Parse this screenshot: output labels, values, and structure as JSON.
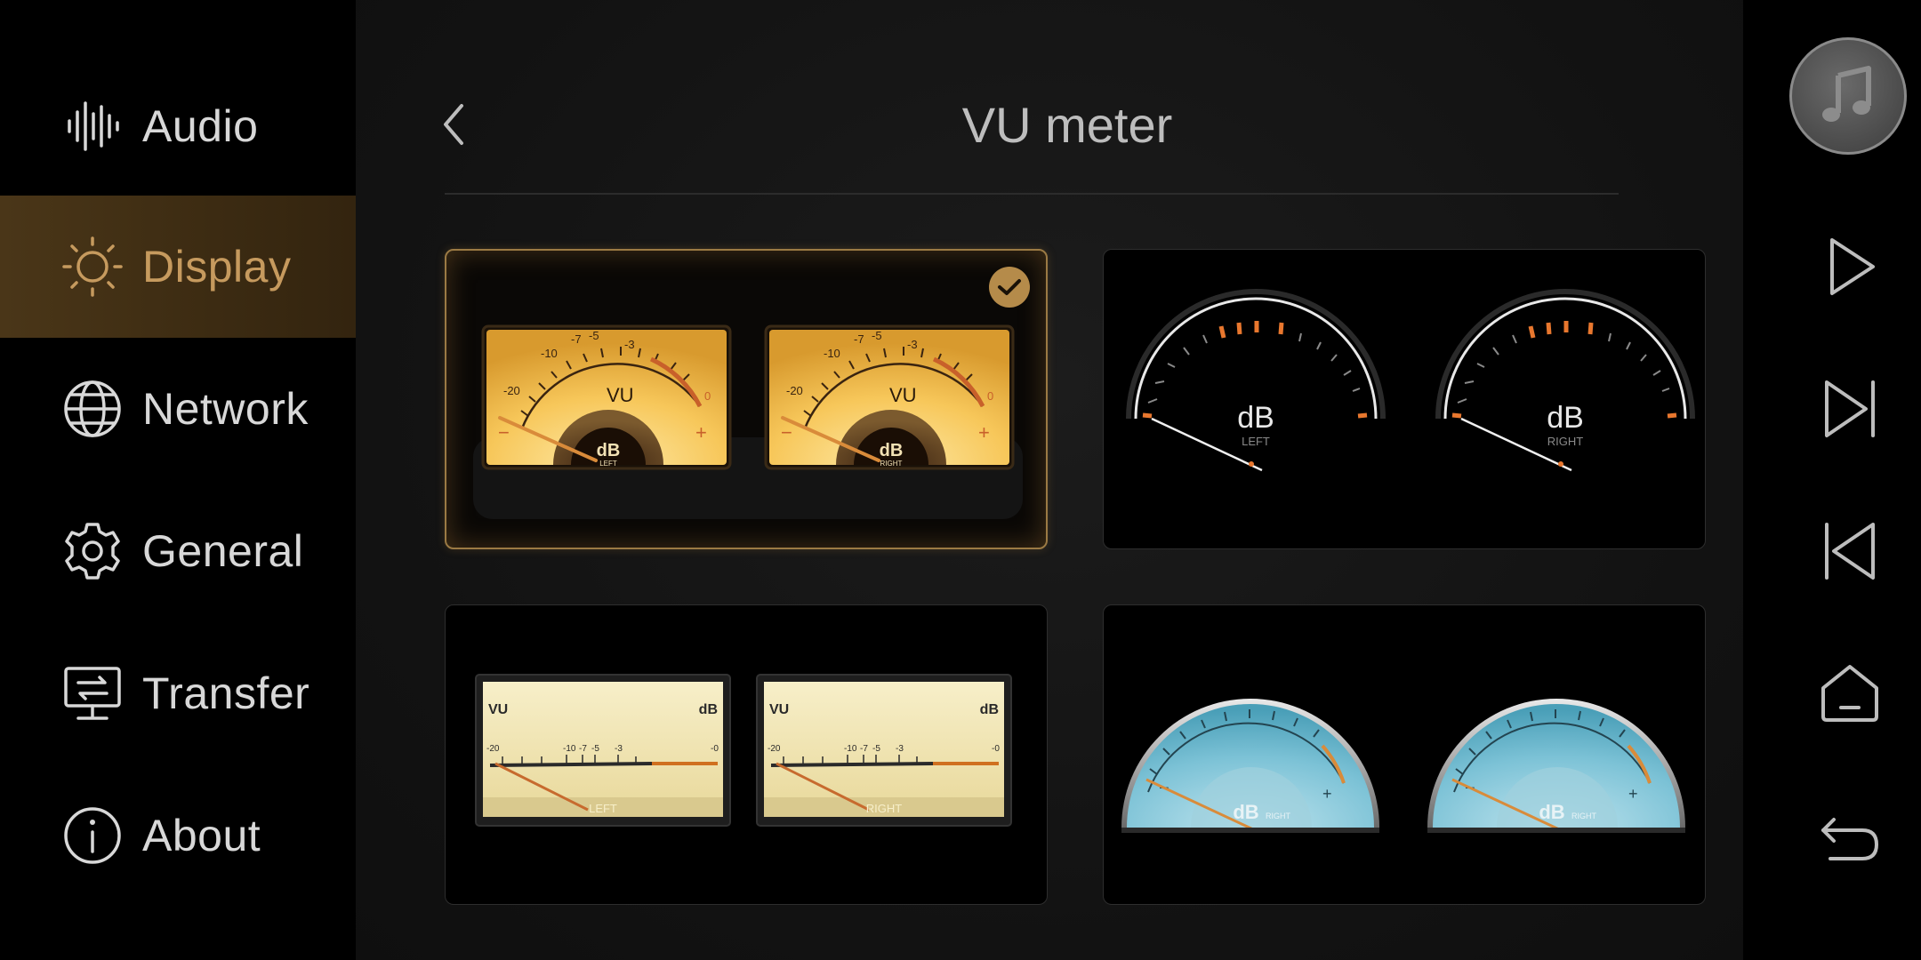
{
  "sidebar": {
    "items": [
      {
        "label": "Audio",
        "icon": "waveform-icon",
        "active": false
      },
      {
        "label": "Display",
        "icon": "brightness-icon",
        "active": true
      },
      {
        "label": "Network",
        "icon": "globe-icon",
        "active": false
      },
      {
        "label": "General",
        "icon": "gear-icon",
        "active": false
      },
      {
        "label": "Transfer",
        "icon": "transfer-icon",
        "active": false
      },
      {
        "label": "About",
        "icon": "info-icon",
        "active": false
      }
    ]
  },
  "header": {
    "title": "VU meter",
    "back_icon": "chevron-left-icon"
  },
  "meters": {
    "card1": {
      "selected": true,
      "vu": "VU",
      "db": "dB",
      "ticks": [
        "-20",
        "-10",
        "-7",
        "-5",
        "-3",
        "0"
      ],
      "minus": "−",
      "plus": "+",
      "left": "LEFT",
      "right": "RIGHT"
    },
    "card2": {
      "db": "dB",
      "left": "LEFT",
      "right": "RIGHT"
    },
    "card3": {
      "vu": "VU",
      "db": "dB",
      "ticks": [
        "-20",
        "-10",
        "-7",
        "-5",
        "-3",
        "-0"
      ],
      "left": "LEFT",
      "right": "RIGHT"
    },
    "card4": {
      "db": "dB",
      "minus": "−",
      "plus": "+",
      "right": "RIGHT"
    }
  },
  "controls": {
    "music": "music-note-icon",
    "play": "play-icon",
    "next": "skip-next-icon",
    "prev": "skip-previous-icon",
    "home": "home-icon",
    "back": "return-icon"
  },
  "colors": {
    "accent": "#c69a5e",
    "active_bg": "#3c2b12",
    "meter_amber": "#f7c75a",
    "meter_cream": "#f1e6b6",
    "meter_blue": "#7cc2d6",
    "needle_orange": "#d98b3a"
  }
}
